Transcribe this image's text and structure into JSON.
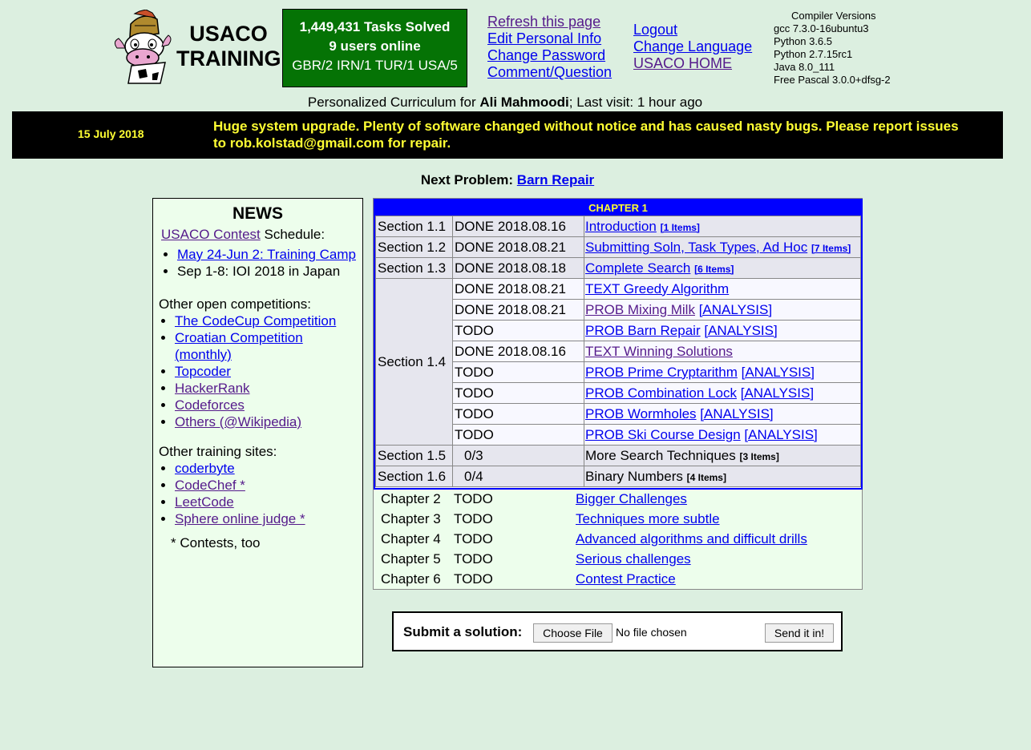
{
  "header": {
    "logo_line1": "USACO",
    "logo_line2": "TRAINING",
    "stats": {
      "tasks_solved": "1,449,431 Tasks Solved",
      "users_online": "9 users online",
      "countries": "GBR/2 IRN/1 TUR/1 USA/5"
    },
    "links_col1": [
      "Refresh this page",
      "Edit Personal Info",
      "Change Password",
      "Comment/Question"
    ],
    "links_col2": [
      "Logout",
      "Change Language",
      "USACO HOME"
    ],
    "compilers": {
      "title": "Compiler Versions",
      "items": [
        "gcc 7.3.0-16ubuntu3",
        "Python 3.6.5",
        "Python 2.7.15rc1",
        "Java 8.0_111",
        "Free Pascal 3.0.0+dfsg-2"
      ]
    }
  },
  "curriculum": {
    "prefix": "Personalized Curriculum for ",
    "user": "Ali Mahmoodi",
    "suffix": "; Last visit: 1 hour ago"
  },
  "banner": {
    "date": "15 July 2018",
    "message": "Huge system upgrade. Plenty of software changed without notice and has caused nasty bugs. Please report issues to rob.kolstad@gmail.com for repair."
  },
  "next_problem": {
    "label": "Next Problem: ",
    "link": "Barn Repair"
  },
  "news": {
    "title": "NEWS",
    "contest_link": "USACO Contest",
    "schedule_suffix": " Schedule:",
    "schedule_items": [
      {
        "text": "May 24-Jun 2: Training Camp",
        "link": true
      },
      {
        "text": "Sep 1-8: IOI 2018 in Japan",
        "link": false
      }
    ],
    "other_competitions_title": "Other open competitions:",
    "other_competitions": [
      {
        "text": "The CodeCup Competition",
        "visited": false
      },
      {
        "text": "Croatian Competition (monthly)",
        "visited": false
      },
      {
        "text": "Topcoder",
        "visited": false
      },
      {
        "text": "HackerRank",
        "visited": true
      },
      {
        "text": "Codeforces",
        "visited": true
      },
      {
        "text": "Others (@Wikipedia)",
        "visited": true
      }
    ],
    "training_sites_title": "Other training sites:",
    "training_sites": [
      {
        "text": "coderbyte",
        "visited": false
      },
      {
        "text": "CodeChef *",
        "visited": true
      },
      {
        "text": "LeetCode",
        "visited": true
      },
      {
        "text": "Sphere online judge *",
        "visited": true
      }
    ],
    "footnote": "* Contests, too"
  },
  "chapter1": {
    "header": "CHAPTER 1",
    "sections": [
      {
        "section": "Section 1.1",
        "status": "DONE 2018.08.16",
        "title": "Introduction",
        "items": "[1 Items]"
      },
      {
        "section": "Section 1.2",
        "status": "DONE 2018.08.21",
        "title": "Submitting Soln, Task Types, Ad Hoc",
        "items": "[7 Items]"
      },
      {
        "section": "Section 1.3",
        "status": "DONE 2018.08.18",
        "title": "Complete Search",
        "items": "[6 Items]"
      }
    ],
    "section14": {
      "section": "Section 1.4",
      "rows": [
        {
          "status": "DONE 2018.08.21",
          "title": "TEXT Greedy Algorithm",
          "analysis": "",
          "visited": false
        },
        {
          "status": "DONE 2018.08.21",
          "title": "PROB Mixing Milk",
          "analysis": "[ANALYSIS]",
          "visited": true
        },
        {
          "status": "TODO",
          "title": "PROB Barn Repair",
          "analysis": "[ANALYSIS]",
          "visited": false
        },
        {
          "status": "DONE 2018.08.16",
          "title": "TEXT Winning Solutions",
          "analysis": "",
          "visited": true
        },
        {
          "status": "TODO",
          "title": "PROB Prime Cryptarithm",
          "analysis": "[ANALYSIS]",
          "visited": false
        },
        {
          "status": "TODO",
          "title": "PROB Combination Lock",
          "analysis": "[ANALYSIS]",
          "visited": false
        },
        {
          "status": "TODO",
          "title": "PROB Wormholes",
          "analysis": "[ANALYSIS]",
          "visited": false
        },
        {
          "status": "TODO",
          "title": "PROB Ski Course Design",
          "analysis": "[ANALYSIS]",
          "visited": false
        }
      ]
    },
    "sections_after": [
      {
        "section": "Section 1.5",
        "status": "0/3",
        "title": "More Search Techniques",
        "items": "[3 Items]"
      },
      {
        "section": "Section 1.6",
        "status": "0/4",
        "title": "Binary Numbers",
        "items": "[4 Items]"
      }
    ]
  },
  "other_chapters": [
    {
      "chapter": "Chapter 2",
      "status": "TODO",
      "title": "Bigger Challenges"
    },
    {
      "chapter": "Chapter 3",
      "status": "TODO",
      "title": "Techniques more subtle"
    },
    {
      "chapter": "Chapter 4",
      "status": "TODO",
      "title": "Advanced algorithms and difficult drills"
    },
    {
      "chapter": "Chapter 5",
      "status": "TODO",
      "title": "Serious challenges"
    },
    {
      "chapter": "Chapter 6",
      "status": "TODO",
      "title": "Contest Practice"
    }
  ],
  "submit": {
    "label": "Submit a solution:",
    "choose_file": "Choose File",
    "no_file": "No file chosen",
    "send": "Send it in!"
  }
}
